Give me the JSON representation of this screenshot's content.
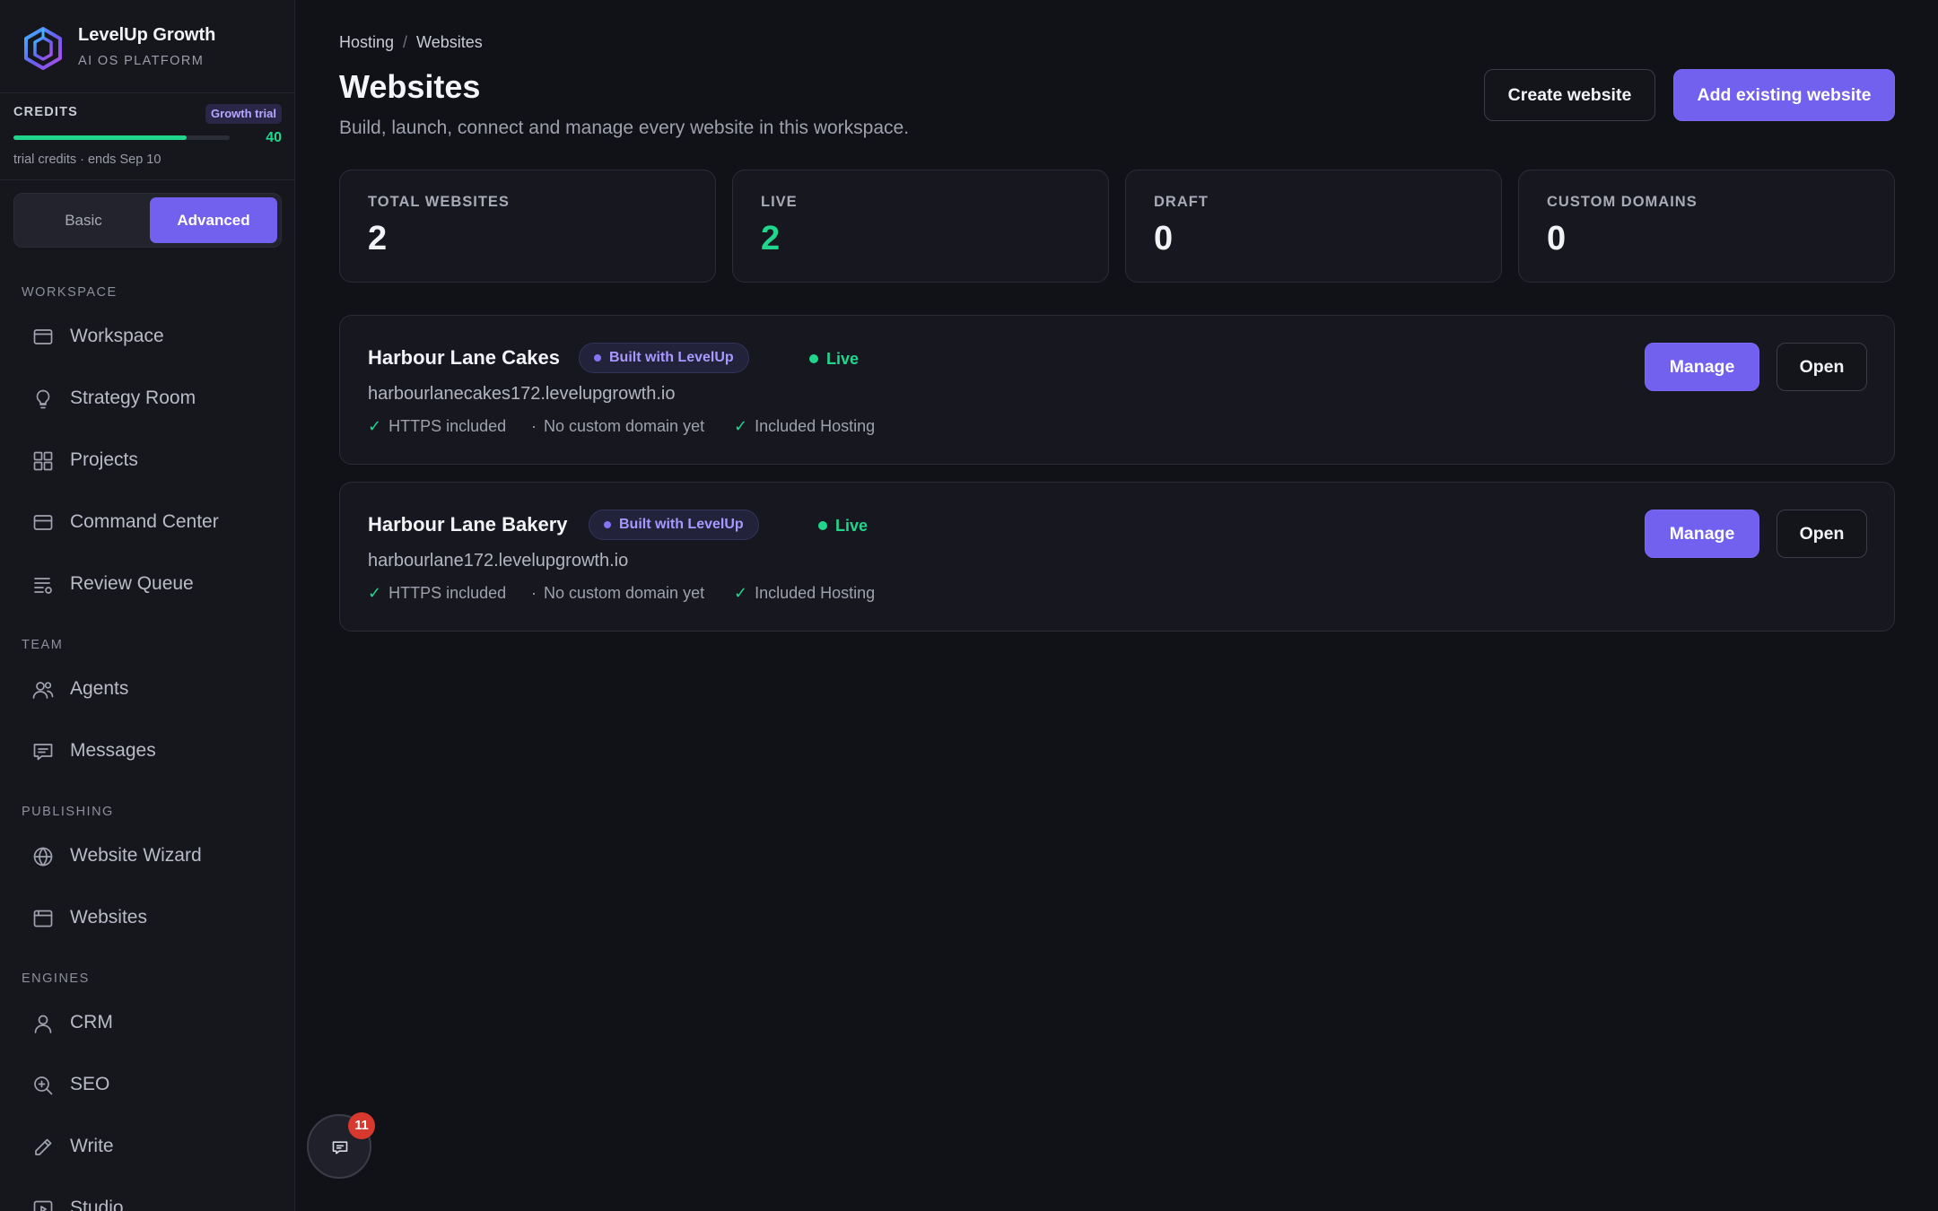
{
  "brand": {
    "name": "LevelUp Growth",
    "subtitle": "AI OS PLATFORM"
  },
  "credits": {
    "label": "CREDITS",
    "badge": "Growth trial",
    "remaining": "40",
    "progress_fraction": 0.8,
    "note": "trial credits · ends Sep 10"
  },
  "mode": {
    "basic": "Basic",
    "advanced": "Advanced",
    "active": "advanced"
  },
  "sidebar": {
    "sections": [
      {
        "title": "WORKSPACE",
        "items": [
          {
            "label": "Workspace",
            "icon": "monitor-icon"
          },
          {
            "label": "Strategy Room",
            "icon": "lightbulb-icon"
          },
          {
            "label": "Projects",
            "icon": "grid-icon"
          },
          {
            "label": "Command Center",
            "icon": "monitor-icon"
          },
          {
            "label": "Review Queue",
            "icon": "list-settings-icon"
          }
        ]
      },
      {
        "title": "TEAM",
        "items": [
          {
            "label": "Agents",
            "icon": "users-icon"
          },
          {
            "label": "Messages",
            "icon": "message-icon"
          }
        ]
      },
      {
        "title": "PUBLISHING",
        "items": [
          {
            "label": "Website Wizard",
            "icon": "globe-icon"
          },
          {
            "label": "Websites",
            "icon": "browser-icon"
          }
        ]
      },
      {
        "title": "ENGINES",
        "items": [
          {
            "label": "CRM",
            "icon": "user-icon"
          },
          {
            "label": "SEO",
            "icon": "search-icon"
          },
          {
            "label": "Write",
            "icon": "pencil-icon"
          },
          {
            "label": "Studio",
            "icon": "play-icon"
          }
        ]
      }
    ]
  },
  "breadcrumb": {
    "parent": "Hosting",
    "separator": "/",
    "current": "Websites"
  },
  "page": {
    "title": "Websites",
    "subtitle": "Build, launch, connect and manage every website in this workspace.",
    "create_label": "Create website",
    "add_label": "Add existing website"
  },
  "stats": [
    {
      "label": "TOTAL WEBSITES",
      "value": "2"
    },
    {
      "label": "LIVE",
      "value": "2"
    },
    {
      "label": "DRAFT",
      "value": "0"
    },
    {
      "label": "CUSTOM DOMAINS",
      "value": "0"
    }
  ],
  "sites": [
    {
      "name": "Harbour Lane Cakes",
      "badge": "Built with LevelUp",
      "status": "Live",
      "domain": "harbourlanecakes172.levelupgrowth.io",
      "features": [
        {
          "mark": "✓",
          "text": "HTTPS included"
        },
        {
          "mark": "·",
          "text": "No custom domain yet"
        },
        {
          "mark": "✓",
          "text": "Included Hosting"
        }
      ],
      "manage_label": "Manage",
      "open_label": "Open"
    },
    {
      "name": "Harbour Lane Bakery",
      "badge": "Built with LevelUp",
      "status": "Live",
      "domain": "harbourlane172.levelupgrowth.io",
      "features": [
        {
          "mark": "✓",
          "text": "HTTPS included"
        },
        {
          "mark": "·",
          "text": "No custom domain yet"
        },
        {
          "mark": "✓",
          "text": "Included Hosting"
        }
      ],
      "manage_label": "Manage",
      "open_label": "Open"
    }
  ],
  "chat": {
    "unread": "11",
    "icon": "chat-icon"
  },
  "colors": {
    "accent": "#7260ee",
    "success": "#20d68d",
    "background": "#111217",
    "danger": "#d8392e"
  }
}
